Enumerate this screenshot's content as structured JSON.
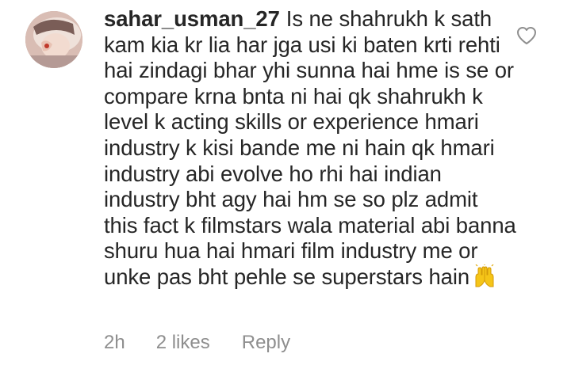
{
  "comment": {
    "username": "sahar_usman_27",
    "text": "Is ne shahrukh k sath kam kia kr lia har jga usi ki baten krti rehti hai zindagi bhar yhi sunna hai hme is se or compare krna bnta ni hai qk shahrukh k level k acting skills or experience hmari industry k kisi bande me ni hain qk hmari industry abi evolve ho rhi hai indian industry bht agy hai hm se so plz admit this fact k filmstars wala material abi banna shuru hua hai hmari film industry me or unke pas bht pehle se superstars hain",
    "emoji_icon": "raising-hands-icon",
    "time": "2h",
    "likes": "2 likes",
    "reply": "Reply"
  },
  "colors": {
    "text": "#262626",
    "meta": "#8e8e8e",
    "heart_outline": "#8e8e8e",
    "emoji": "#f5c518"
  }
}
